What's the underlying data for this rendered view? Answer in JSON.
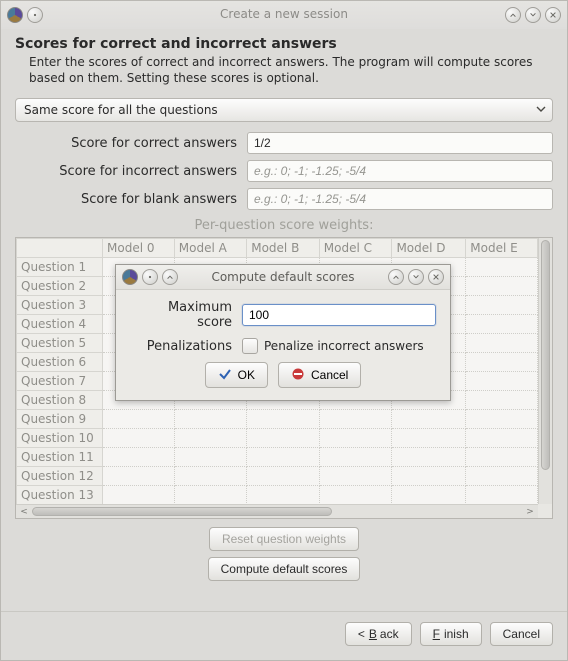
{
  "window": {
    "title": "Create a new session"
  },
  "page": {
    "heading": "Scores for correct and incorrect answers",
    "description": "Enter the scores of correct and incorrect answers. The program will compute scores based on them. Setting these scores is optional."
  },
  "dropdown": {
    "selected": "Same score for all the questions"
  },
  "fields": {
    "correct": {
      "label": "Score for correct answers",
      "value": "1/2",
      "placeholder": ""
    },
    "incorrect": {
      "label": "Score for incorrect answers",
      "value": "",
      "placeholder": "e.g.: 0; -1; -1.25; -5/4"
    },
    "blank": {
      "label": "Score for blank answers",
      "value": "",
      "placeholder": "e.g.: 0; -1; -1.25; -5/4"
    }
  },
  "weights": {
    "label": "Per-question score weights:",
    "columns": [
      "Model 0",
      "Model A",
      "Model B",
      "Model C",
      "Model D",
      "Model E"
    ],
    "rows": [
      "Question 1",
      "Question 2",
      "Question 3",
      "Question 4",
      "Question 5",
      "Question 6",
      "Question 7",
      "Question 8",
      "Question 9",
      "Question 10",
      "Question 11",
      "Question 12",
      "Question 13"
    ]
  },
  "buttons": {
    "reset": "Reset question weights",
    "compute": "Compute default scores",
    "back": "Back",
    "finish": "Finish",
    "cancel": "Cancel",
    "ok": "OK"
  },
  "modal": {
    "title": "Compute default scores",
    "max_label": "Maximum score",
    "max_value": "100",
    "penal_label": "Penalizations",
    "penal_text": "Penalize incorrect answers",
    "penalize_checked": false
  }
}
